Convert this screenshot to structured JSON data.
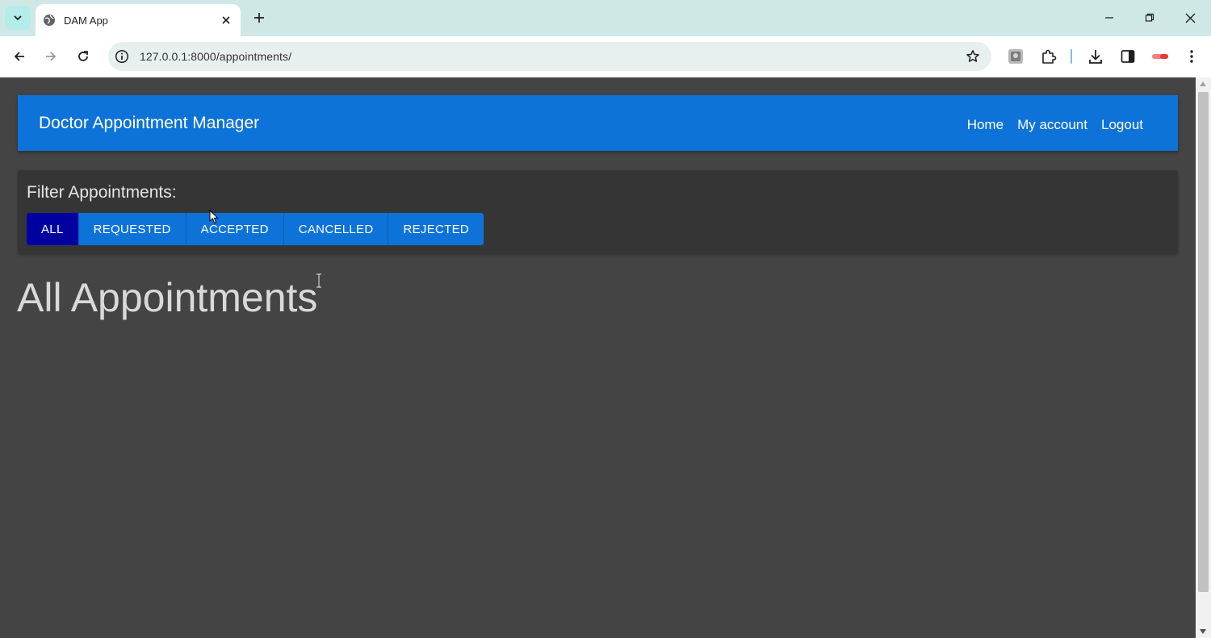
{
  "browser": {
    "tab_title": "DAM App",
    "url": "127.0.0.1:8000/appointments/",
    "icons": {
      "tab_search": "chevron-down-icon",
      "favicon": "globe-icon",
      "tab_close": "close-icon",
      "new_tab": "plus-icon",
      "back": "arrow-left-icon",
      "forward": "arrow-right-icon",
      "reload": "reload-icon",
      "site_info": "info-icon",
      "bookmark": "star-icon",
      "extensions": "puzzle-icon",
      "downloads": "download-icon",
      "side_panel": "side-panel-icon",
      "menu": "kebab-menu-icon"
    }
  },
  "app": {
    "brand": "Doctor Appointment Manager",
    "nav": [
      {
        "label": "Home"
      },
      {
        "label": "My account"
      },
      {
        "label": "Logout"
      }
    ],
    "filter": {
      "label": "Filter Appointments:",
      "options": [
        {
          "label": "ALL",
          "active": true
        },
        {
          "label": "REQUESTED",
          "active": false
        },
        {
          "label": "ACCEPTED",
          "active": false
        },
        {
          "label": "CANCELLED",
          "active": false
        },
        {
          "label": "REJECTED",
          "active": false
        }
      ]
    },
    "heading": "All Appointments"
  },
  "colors": {
    "page_bg": "#444444",
    "navbar_bg": "#0d73d9",
    "button_bg": "#0d73d9",
    "button_active_bg": "#0000a0",
    "card_bg": "#353535",
    "heading_text": "#d9d9d9"
  }
}
